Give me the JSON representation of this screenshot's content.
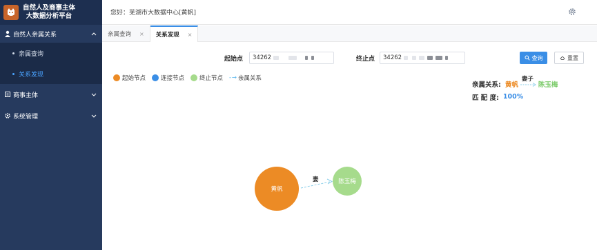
{
  "sidebar": {
    "brand_line1": "自然人及商事主体",
    "brand_line2": "大数据分析平台",
    "groups": [
      {
        "label": "自然人亲属关系",
        "expanded": true,
        "items": [
          {
            "label": "亲属查询",
            "active": false
          },
          {
            "label": "关系发现",
            "active": true
          }
        ]
      },
      {
        "label": "商事主体",
        "expanded": false
      },
      {
        "label": "系统管理",
        "expanded": false
      }
    ]
  },
  "header": {
    "greeting": "您好：芜湖市大数据中心[黄帆]"
  },
  "tabs": [
    {
      "label": "亲属查询",
      "close": "×",
      "active": false
    },
    {
      "label": "关系发现",
      "close": "×",
      "active": true
    }
  ],
  "search": {
    "start_label": "起始点",
    "start_value": "34262",
    "end_label": "终止点",
    "end_value": "34262",
    "query_label": "查询",
    "reset_label": "重置"
  },
  "legend": {
    "start": "起始节点",
    "connect": "连接节点",
    "end": "终止节点",
    "relation_arrow": "- →",
    "relation": "亲属关系"
  },
  "relation_info": {
    "relation_label": "亲属关系:",
    "from": "黄帆",
    "edge": "妻子",
    "to": "陈玉梅",
    "match_label": "匹 配 度:",
    "match_value": "100%"
  },
  "graph": {
    "source_node": "黄帆",
    "target_node": "陈玉梅",
    "edge_label": "妻"
  },
  "colors": {
    "sidebar_bg": "#263a5e",
    "accent": "#3a8ee6",
    "start_node": "#ec8b25",
    "connect_node": "#3a8ee6",
    "end_node": "#a6db8c",
    "relation_edge": "#8ccfea"
  }
}
